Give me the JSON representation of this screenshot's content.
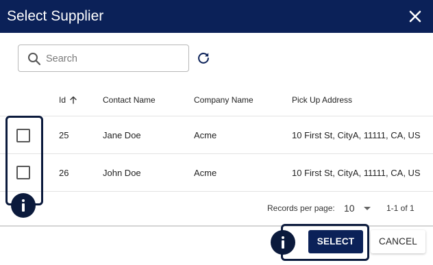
{
  "dialog": {
    "title": "Select Supplier",
    "close_icon": "close-icon"
  },
  "search": {
    "placeholder": "Search",
    "value": "",
    "icon": "search-icon",
    "refresh_icon": "refresh-icon"
  },
  "table": {
    "columns": [
      {
        "label": "Id",
        "sort": "ascending"
      },
      {
        "label": "Contact Name"
      },
      {
        "label": "Company Name"
      },
      {
        "label": "Pick Up Address"
      }
    ],
    "rows": [
      {
        "id": "25",
        "contact_name": "Jane Doe",
        "company_name": "Acme",
        "address": "10 First St, CityA, 11111, CA, US",
        "checked": false
      },
      {
        "id": "26",
        "contact_name": "John Doe",
        "company_name": "Acme",
        "address": "10 First St, CityA, 11111, CA, US",
        "checked": false
      }
    ]
  },
  "pagination": {
    "records_label": "Records per page:",
    "per_page": "10",
    "range": "1-1 of 1"
  },
  "footer": {
    "select_label": "SELECT",
    "cancel_label": "CANCEL"
  },
  "colors": {
    "header_bg": "#0b2158",
    "primary_button": "#0b2158",
    "highlight": "#0b1a3c"
  }
}
